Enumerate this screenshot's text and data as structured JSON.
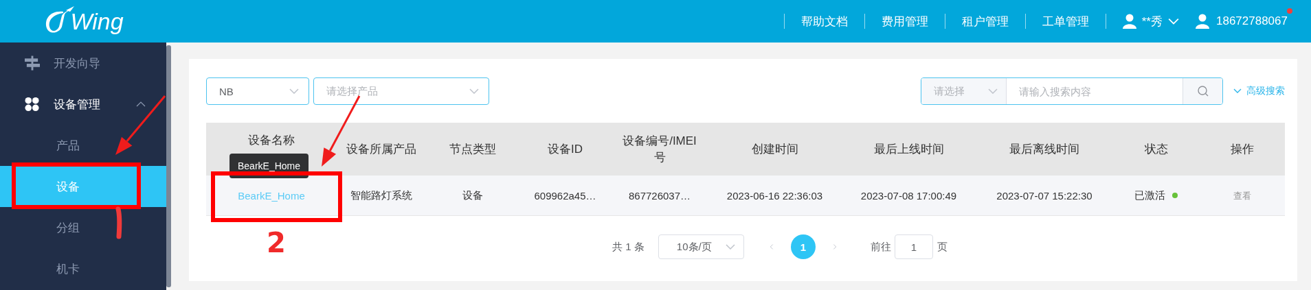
{
  "header": {
    "logo": "Wing",
    "nav": [
      "帮助文档",
      "费用管理",
      "租户管理",
      "工单管理"
    ],
    "user": "**秀",
    "phone": "18672788067",
    "notification": true
  },
  "sidebar": {
    "items": [
      {
        "label": "开发向导",
        "kind": "link"
      },
      {
        "label": "设备管理",
        "kind": "group",
        "expanded": true,
        "children": [
          {
            "label": "产品",
            "selected": false
          },
          {
            "label": "设备",
            "selected": true
          },
          {
            "label": "分组",
            "selected": false
          },
          {
            "label": "机卡",
            "selected": false
          }
        ]
      }
    ]
  },
  "filters": {
    "type_value": "NB",
    "product_placeholder": "请选择产品",
    "search_select_placeholder": "请选择",
    "search_placeholder": "请输入搜索内容",
    "advanced": "高级搜索"
  },
  "table": {
    "columns": [
      "设备名称",
      "设备所属产品",
      "节点类型",
      "设备ID",
      "设备编号/IMEI号",
      "创建时间",
      "最后上线时间",
      "最后离线时间",
      "状态",
      "操作"
    ],
    "rows": [
      {
        "name": "BearkE_Home",
        "product": "智能路灯系统",
        "node_type": "设备",
        "device_id": "609962a45…",
        "imei": "867726037…",
        "created": "2023-06-16 22:36:03",
        "last_online": "2023-07-08 17:00:49",
        "last_offline": "2023-07-07 15:22:30",
        "status": "已激活",
        "color": "#67c23a",
        "action": "查看"
      }
    ],
    "tooltip": "BearkE_Home"
  },
  "pagination": {
    "total": "共 1 条",
    "page_size": "10条/页",
    "pages": [
      {
        "label": "1",
        "selected": true
      }
    ],
    "goto_label": "前往",
    "goto_value": "1",
    "goto_suffix": "页"
  },
  "annotations": [
    {
      "kind": "box"
    },
    {
      "kind": "box"
    },
    {
      "kind": "arrow"
    },
    {
      "kind": "arrow"
    },
    {
      "kind": "stroke"
    },
    {
      "kind": "mark",
      "text": "2"
    }
  ]
}
